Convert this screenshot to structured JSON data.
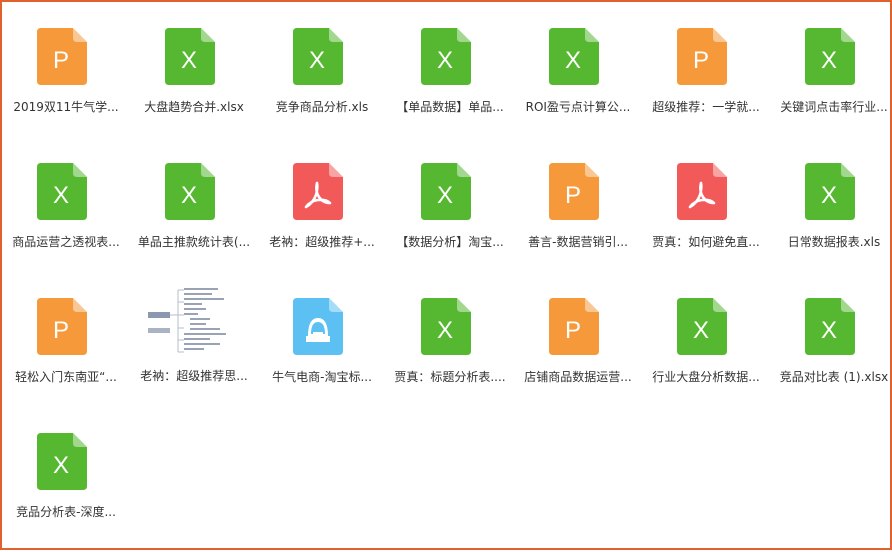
{
  "colors": {
    "frame_border": "#e0602e",
    "xls": "#56b830",
    "ppt": "#f5993b",
    "pdf": "#f25a5a",
    "img": "#5cc1f2"
  },
  "files": [
    {
      "name": "2019双11牛气学...",
      "type": "ppt",
      "icon": "ppt-file-icon",
      "letter": "P"
    },
    {
      "name": "大盘趋势合并.xlsx",
      "type": "xls",
      "icon": "excel-file-icon",
      "letter": "X"
    },
    {
      "name": "竞争商品分析.xls",
      "type": "xls",
      "icon": "excel-file-icon",
      "letter": "X"
    },
    {
      "name": "【单品数据】单品...",
      "type": "xls",
      "icon": "excel-file-icon",
      "letter": "X"
    },
    {
      "name": "ROI盈亏点计算公...",
      "type": "xls",
      "icon": "excel-file-icon",
      "letter": "X"
    },
    {
      "name": "超级推荐：一学就...",
      "type": "ppt",
      "icon": "ppt-file-icon",
      "letter": "P"
    },
    {
      "name": "关键词点击率行业...",
      "type": "xls",
      "icon": "excel-file-icon",
      "letter": "X"
    },
    {
      "name": "商品运营之透视表...",
      "type": "xls",
      "icon": "excel-file-icon",
      "letter": "X"
    },
    {
      "name": "单品主推款统计表(...",
      "type": "xls",
      "icon": "excel-file-icon",
      "letter": "X"
    },
    {
      "name": "老衲：超级推荐+...",
      "type": "pdf",
      "icon": "pdf-file-icon",
      "letter": ""
    },
    {
      "name": "【数据分析】淘宝...",
      "type": "xls",
      "icon": "excel-file-icon",
      "letter": "X"
    },
    {
      "name": "善言-数据营销引...",
      "type": "ppt",
      "icon": "ppt-file-icon",
      "letter": "P"
    },
    {
      "name": "贾真：如何避免直...",
      "type": "pdf",
      "icon": "pdf-file-icon",
      "letter": ""
    },
    {
      "name": "日常数据报表.xls",
      "type": "xls",
      "icon": "excel-file-icon",
      "letter": "X"
    },
    {
      "name": "轻松入门东南亚“...",
      "type": "ppt",
      "icon": "ppt-file-icon",
      "letter": "P"
    },
    {
      "name": "老衲：超级推荐思...",
      "type": "thumb",
      "icon": "mindmap-thumbnail",
      "letter": ""
    },
    {
      "name": "牛气电商-淘宝标...",
      "type": "img",
      "icon": "image-file-icon",
      "letter": ""
    },
    {
      "name": "贾真：标题分析表....",
      "type": "xls",
      "icon": "excel-file-icon",
      "letter": "X"
    },
    {
      "name": "店铺商品数据运营...",
      "type": "ppt",
      "icon": "ppt-file-icon",
      "letter": "P"
    },
    {
      "name": "行业大盘分析数据...",
      "type": "xls",
      "icon": "excel-file-icon",
      "letter": "X"
    },
    {
      "name": "竞品对比表 (1).xlsx",
      "type": "xls",
      "icon": "excel-file-icon",
      "letter": "X"
    },
    {
      "name": "竞品分析表-深度...",
      "type": "xls",
      "icon": "excel-file-icon",
      "letter": "X"
    }
  ]
}
